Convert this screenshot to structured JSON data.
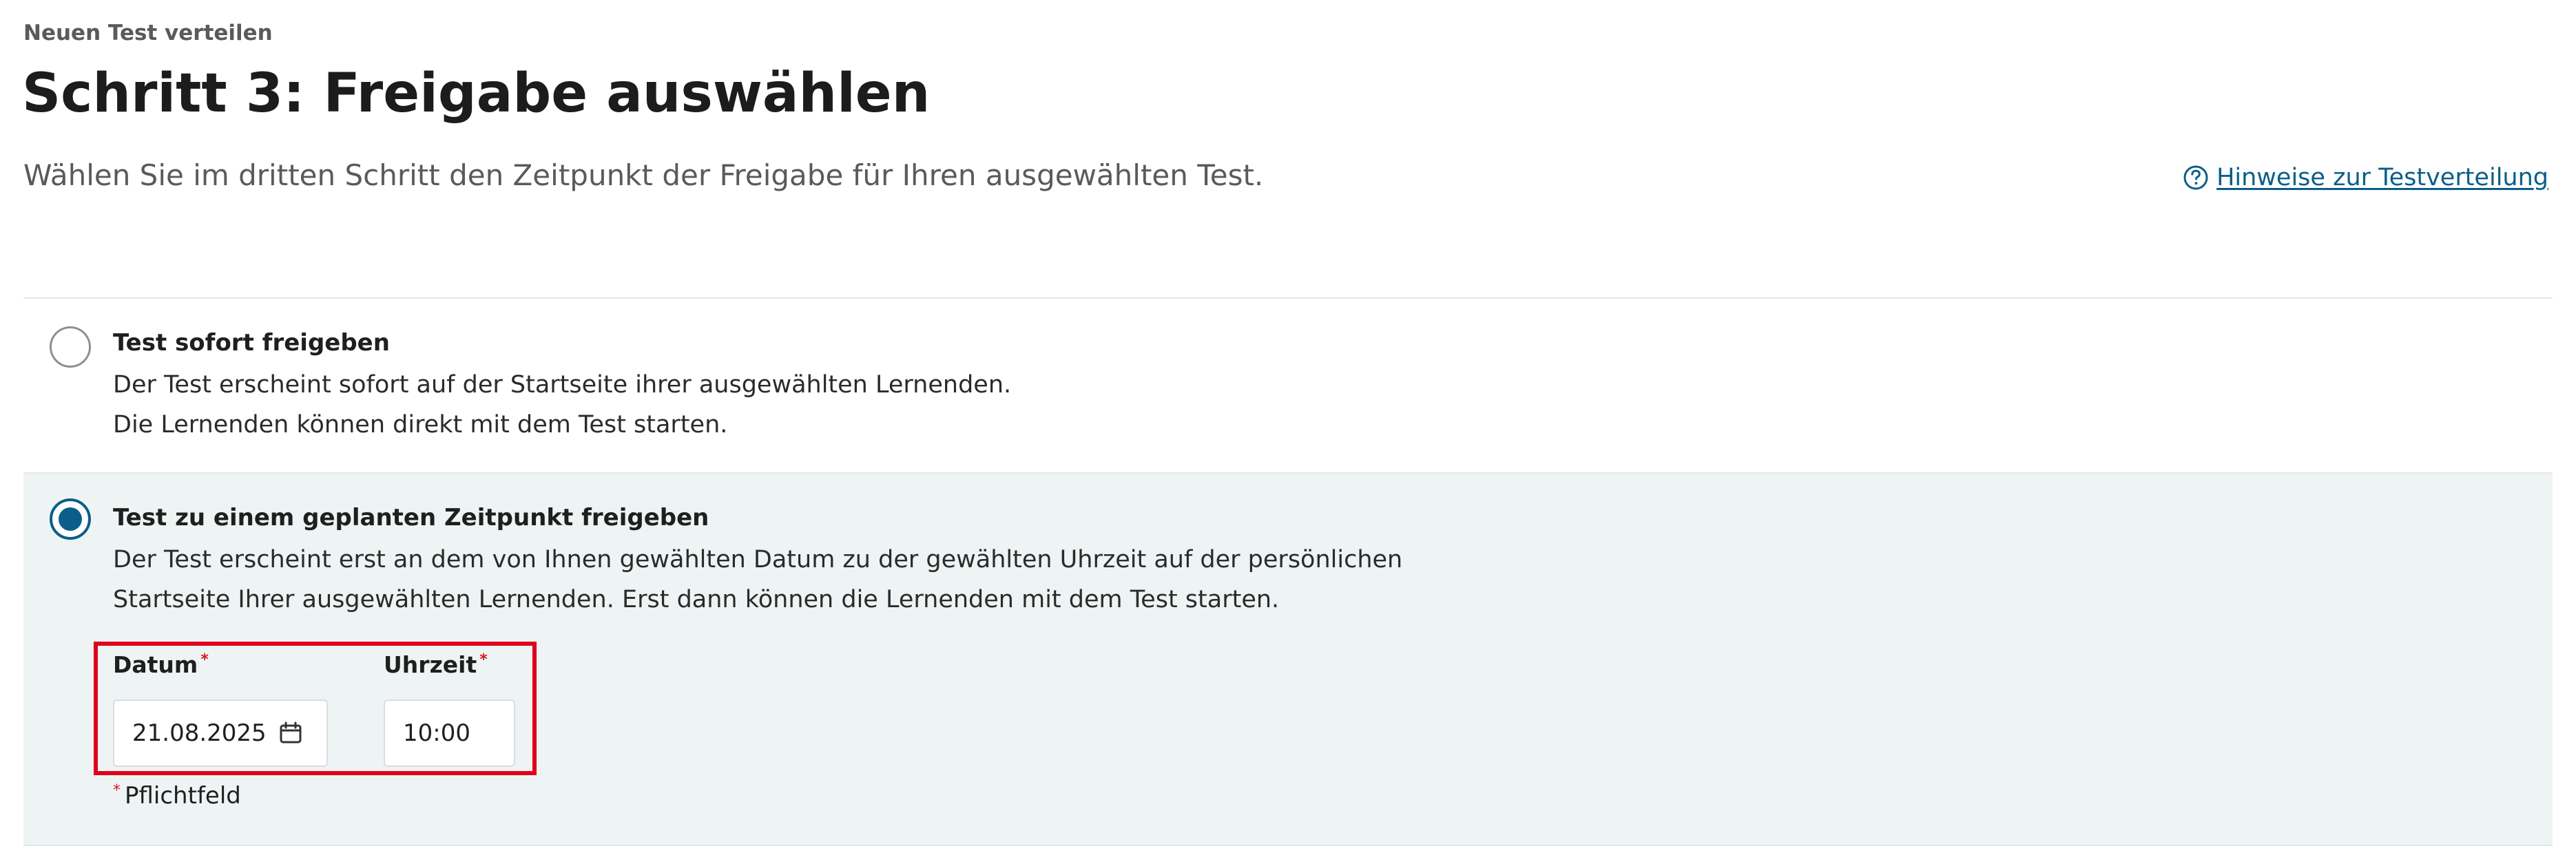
{
  "header": {
    "overline": "Neuen Test verteilen",
    "title": "Schritt 3: Freigabe auswählen",
    "subtitle": "Wählen Sie im dritten Schritt den Zeitpunkt der Freigabe für Ihren ausgewählten Test.",
    "hint_link": "Hinweise zur Testverteilung",
    "hint_icon": "help-circle-icon"
  },
  "options": [
    {
      "title": "Test sofort freigeben",
      "line1": "Der Test erscheint sofort auf der Startseite ihrer ausgewählten Lernenden.",
      "line2": "Die Lernenden können direkt mit dem Test starten.",
      "selected": false
    },
    {
      "title": "Test zu einem geplanten Zeitpunkt freigeben",
      "line1": "Der Test erscheint erst an dem von Ihnen gewählten Datum zu der gewählten Uhrzeit auf der persönlichen",
      "line2": "Startseite Ihrer ausgewählten Lernenden. Erst dann können die Lernenden mit dem Test starten.",
      "selected": true
    }
  ],
  "schedule": {
    "date_label": "Datum",
    "date_value": "21.08.2025",
    "date_icon": "calendar-icon",
    "time_label": "Uhrzeit",
    "time_value": "10:00",
    "required_mark": "*",
    "required_note": "Pflichtfeld"
  },
  "colors": {
    "accent": "#0b5e89",
    "highlight": "#e0001b",
    "selected_background": "#eef4f4",
    "required": "#d71920"
  }
}
